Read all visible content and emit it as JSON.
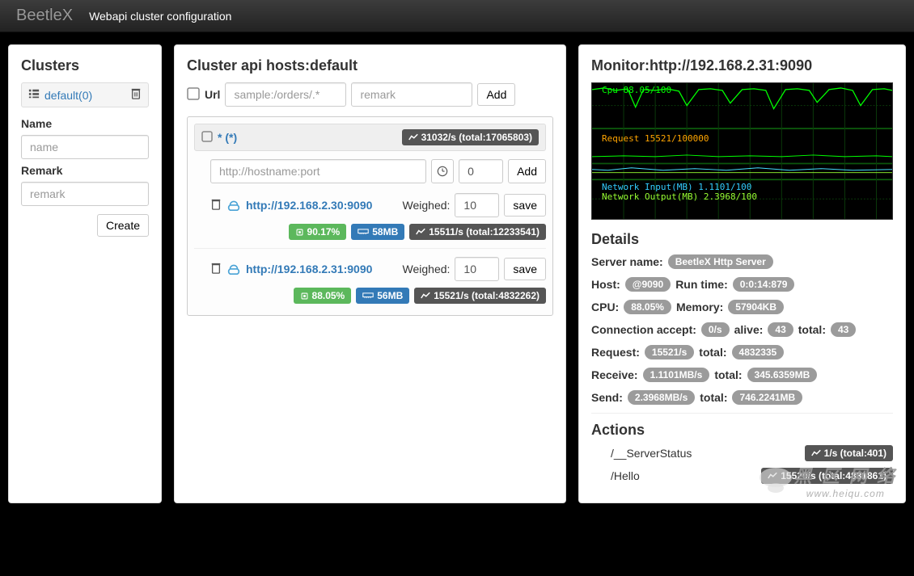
{
  "navbar": {
    "brand": "BeetleX",
    "link": "Webapi cluster configuration"
  },
  "sidebar": {
    "title": "Clusters",
    "cluster_item": "default(0)",
    "name_label": "Name",
    "name_placeholder": "name",
    "remark_label": "Remark",
    "remark_placeholder": "remark",
    "create_btn": "Create"
  },
  "main": {
    "title": "Cluster api hosts:default",
    "url_label": "Url",
    "url_placeholder": "sample:/orders/.*",
    "remark_placeholder": "remark",
    "add_btn": "Add",
    "group": {
      "name": "* (*)",
      "stats": "31032/s (total:17065803)",
      "host_placeholder": "http://hostname:port",
      "weight_value": "0",
      "add_btn": "Add",
      "weighted_label": "Weighed:",
      "save_btn": "save",
      "hosts": [
        {
          "url": "http://192.168.2.30:9090",
          "weight": "10",
          "cpu": "90.17%",
          "mem": "58MB",
          "stats": "15511/s (total:12233541)"
        },
        {
          "url": "http://192.168.2.31:9090",
          "weight": "10",
          "cpu": "88.05%",
          "mem": "56MB",
          "stats": "15521/s (total:4832262)"
        }
      ]
    }
  },
  "monitor": {
    "title": "Monitor:http://192.168.2.31:9090",
    "cpu_label": "Cpu 88.05/100",
    "req_label": "Request 15521/100000",
    "net_in_label": "Network Input(MB) 1.1101/100",
    "net_out_label": "Network Output(MB) 2.3968/100",
    "details_title": "Details",
    "server_name_label": "Server name:",
    "server_name": "BeetleX Http Server",
    "host_label": "Host:",
    "host": "@9090",
    "runtime_label": "Run time:",
    "runtime": "0:0:14:879",
    "cpu_dlabel": "CPU:",
    "cpu": "88.05%",
    "mem_label": "Memory:",
    "mem": "57904KB",
    "conn_label": "Connection accept:",
    "conn_accept": "0/s",
    "alive_label": "alive:",
    "alive": "43",
    "total_label": "total:",
    "conn_total": "43",
    "request_label": "Request:",
    "request": "15521/s",
    "request_total": "4832335",
    "receive_label": "Receive:",
    "receive": "1.1101MB/s",
    "receive_total": "345.6359MB",
    "send_label": "Send:",
    "send": "2.3968MB/s",
    "send_total": "746.2241MB",
    "actions_title": "Actions",
    "actions": [
      {
        "path": "/__ServerStatus",
        "stat": "1/s (total:401)"
      },
      {
        "path": "/Hello",
        "stat": "15520/s (total:4831861)"
      }
    ]
  },
  "watermark": {
    "cn": "黑 区 网 络",
    "url": "www.heiqu.com"
  },
  "chart_data": {
    "type": "line",
    "series": [
      {
        "name": "Cpu",
        "color": "#00ff00",
        "range": [
          0,
          100
        ],
        "values": [
          88,
          90,
          87,
          92,
          60,
          88,
          85,
          89,
          91,
          87,
          86,
          88,
          70,
          89,
          90,
          88,
          92,
          75,
          88,
          87,
          85,
          89,
          90
        ]
      },
      {
        "name": "Request",
        "color": "#ffa500",
        "range": [
          0,
          100000
        ],
        "values": [
          15521
        ]
      },
      {
        "name": "Network Input(MB)",
        "color": "#33ccff",
        "range": [
          0,
          100
        ],
        "values": [
          1.1101
        ]
      },
      {
        "name": "Network Output(MB)",
        "color": "#99ff33",
        "range": [
          0,
          100
        ],
        "values": [
          2.3968
        ]
      }
    ]
  }
}
